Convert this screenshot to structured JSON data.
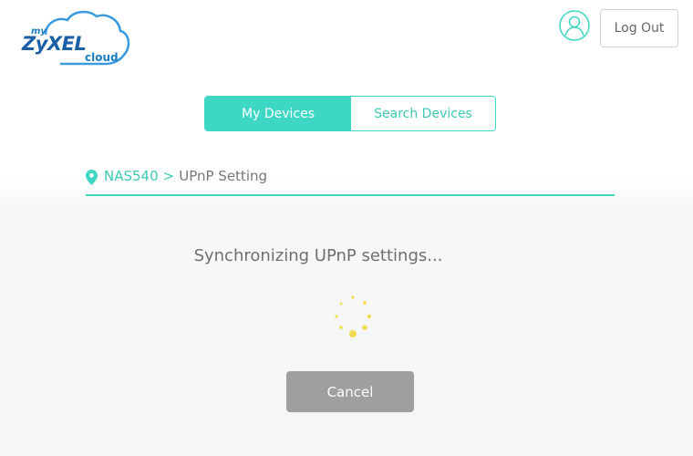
{
  "header": {
    "logo": {
      "prefix": "my",
      "brand": "ZyXEL",
      "suffix": "cloud"
    },
    "user_icon": "user-circle-icon",
    "logout_label": "Log Out"
  },
  "tabs": [
    {
      "label": "My Devices",
      "active": true
    },
    {
      "label": "Search Devices",
      "active": false
    }
  ],
  "breadcrumb": {
    "icon": "location-pin-icon",
    "device": "NAS540",
    "separator": ">",
    "page": "UPnP Setting"
  },
  "main": {
    "status_text": "Synchronizing UPnP settings...",
    "spinner_icon": "loading-spinner-icon",
    "cancel_label": "Cancel"
  },
  "colors": {
    "accent": "#3dd7c3",
    "brand_blue": "#1a5fa8",
    "spinner": "#f0dc50",
    "cancel_bg": "#9f9f9f"
  }
}
